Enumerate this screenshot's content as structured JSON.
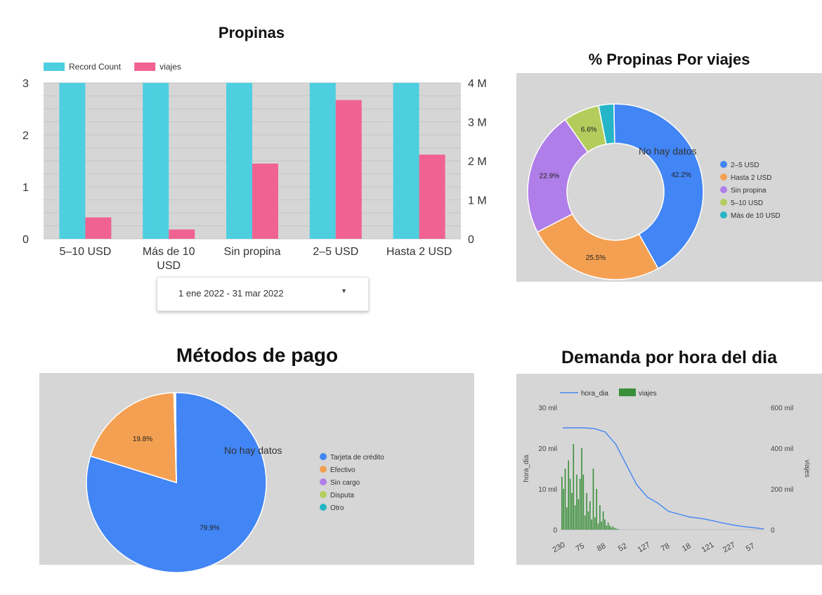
{
  "chart_data": [
    {
      "type": "bar",
      "title": "Propinas",
      "categories": [
        "5–10 USD",
        "Más de 10 USD",
        "Sin propina",
        "2–5 USD",
        "Hasta 2 USD"
      ],
      "series": [
        {
          "name": "Record Count",
          "axis": "left",
          "color": "#4dcfe0",
          "values": [
            3,
            3,
            3,
            3,
            3
          ]
        },
        {
          "name": "viajes",
          "axis": "right",
          "color": "#f06292",
          "values": [
            550000,
            240000,
            1930000,
            3560000,
            2160000
          ]
        }
      ],
      "ylim_left": [
        0,
        3
      ],
      "ylim_right": [
        0,
        4000000
      ],
      "left_ticks": [
        "0",
        "1",
        "2",
        "3"
      ],
      "right_ticks": [
        "0",
        "1 M",
        "2 M",
        "3 M",
        "4 M"
      ],
      "legend": "top-left",
      "grid": true
    },
    {
      "type": "pie",
      "donut": true,
      "title": "% Propinas Por viajes",
      "overlay_text": "No hay datos",
      "slices": [
        {
          "label": "2–5 USD",
          "value": 42.2,
          "display": "42.2%",
          "color": "#4285f4"
        },
        {
          "label": "Hasta 2 USD",
          "value": 25.5,
          "display": "25.5%",
          "color": "#f4a052"
        },
        {
          "label": "Sin propina",
          "value": 22.9,
          "display": "22.9%",
          "color": "#b07ee8"
        },
        {
          "label": "5–10 USD",
          "value": 6.6,
          "display": "6.6%",
          "color": "#b4cc5c"
        },
        {
          "label": "Más de 10 USD",
          "value": 2.8,
          "display": "",
          "color": "#26b5c6"
        }
      ],
      "legend": "right"
    },
    {
      "type": "pie",
      "title": "Métodos de pago",
      "overlay_text": "No hay datos",
      "slices": [
        {
          "label": "Tarjeta de crédito",
          "value": 79.9,
          "display": "79.9%",
          "color": "#4285f4"
        },
        {
          "label": "Efectivo",
          "value": 19.8,
          "display": "19.8%",
          "color": "#f4a052"
        },
        {
          "label": "Sin cargo",
          "value": 0.15,
          "display": "",
          "color": "#b07ee8"
        },
        {
          "label": "Disputa",
          "value": 0.1,
          "display": "",
          "color": "#b4cc5c"
        },
        {
          "label": "Otro",
          "value": 0.05,
          "display": "",
          "color": "#26b5c6"
        }
      ],
      "legend": "right"
    },
    {
      "type": "line",
      "title": "Demanda por hora del dia",
      "series": [
        {
          "name": "hora_dia",
          "color": "#4285f4",
          "axis": "left"
        },
        {
          "name": "viajes",
          "color": "#3a8f3a",
          "axis": "right"
        }
      ],
      "xlabel": "",
      "ylabel_left": "hora_dia",
      "ylabel_right": "viajes",
      "ylim_left": [
        0,
        30000
      ],
      "ylim_right": [
        0,
        600000
      ],
      "left_ticks": [
        "0",
        "10 mil",
        "20 mil",
        "30 mil"
      ],
      "right_ticks": [
        "0",
        "200 mil",
        "400 mil",
        "600 mil"
      ],
      "x_tick_labels": [
        "230",
        "75",
        "88",
        "52",
        "127",
        "78",
        "18",
        "121",
        "227",
        "57"
      ],
      "hora_dia_curve": [
        25000,
        25000,
        25000,
        24800,
        24000,
        21000,
        16000,
        11000,
        8000,
        6500,
        4500,
        3800,
        3100,
        2800,
        2300,
        1700,
        1200,
        800,
        500,
        200
      ],
      "viajes_bars": [
        260000,
        200000,
        300000,
        110000,
        340000,
        250000,
        180000,
        420000,
        120000,
        270000,
        150000,
        250000,
        400000,
        270000,
        70000,
        180000,
        90000,
        140000,
        50000,
        300000,
        60000,
        200000,
        30000,
        120000,
        40000,
        90000,
        50000,
        20000,
        35000,
        20000,
        12000,
        15000,
        8000,
        5000,
        3000
      ],
      "legend": "top-left"
    }
  ],
  "date_selector": {
    "value": "1 ene 2022 - 31 mar 2022"
  }
}
